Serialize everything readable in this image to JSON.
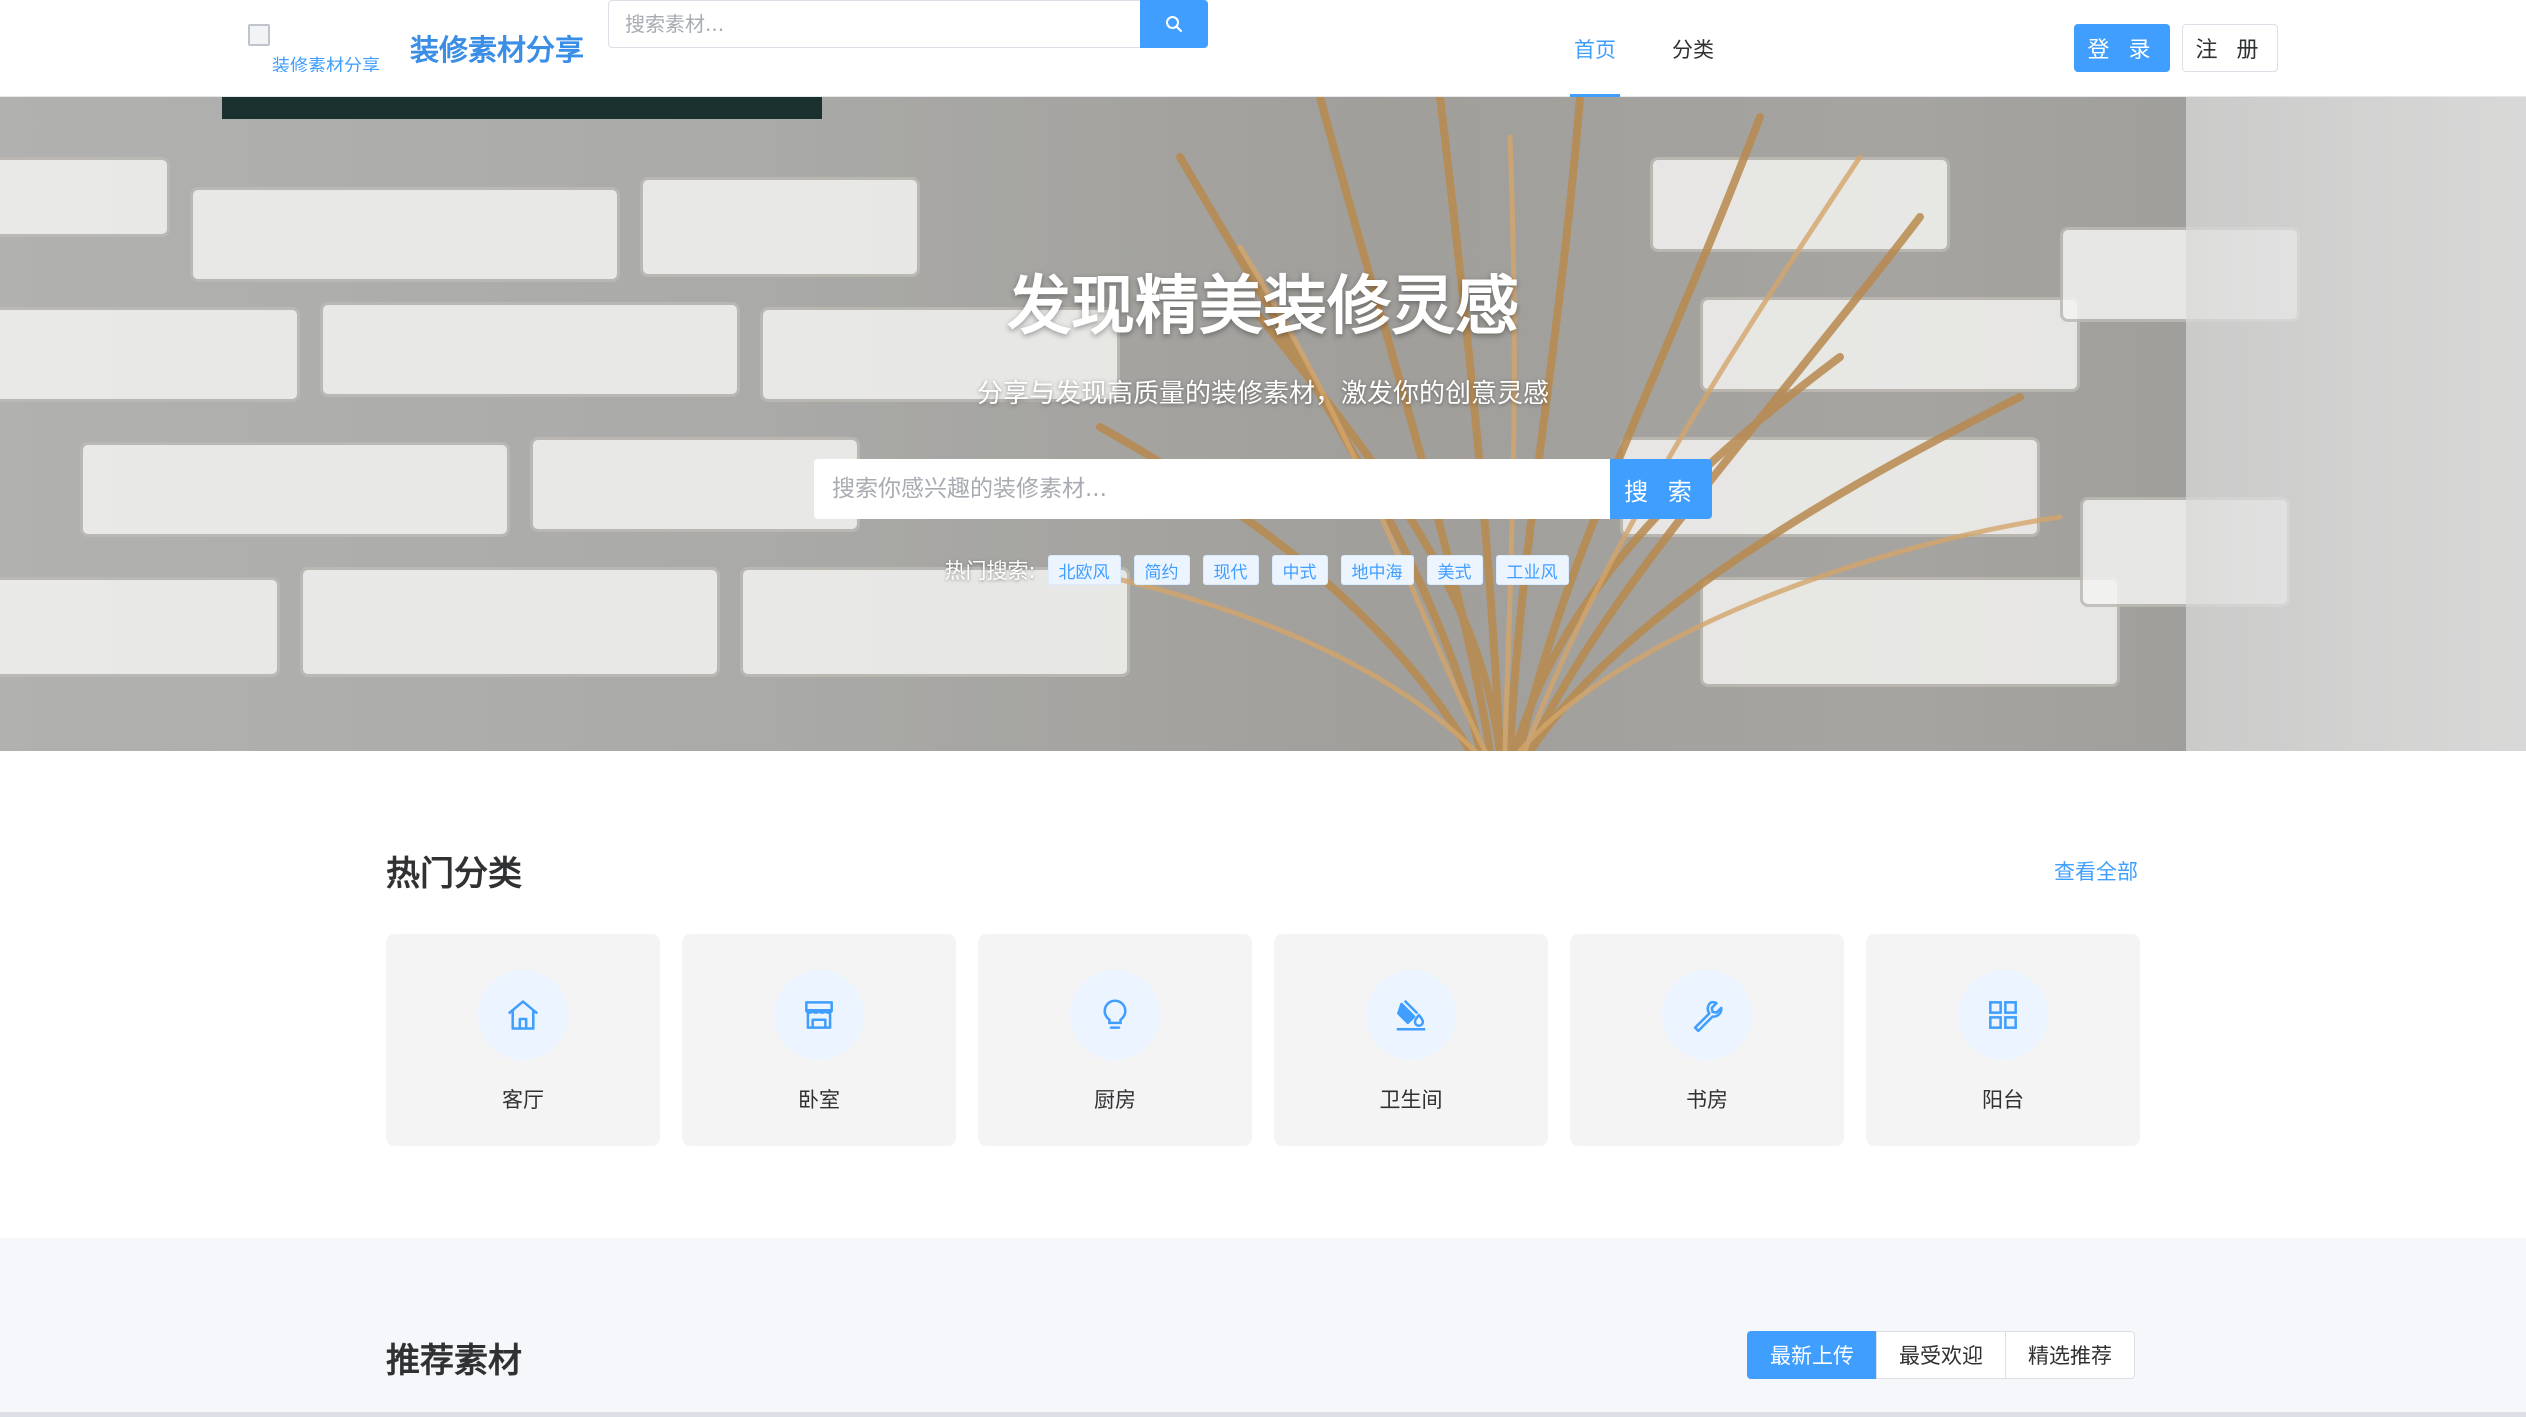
{
  "brand": {
    "logo_alt": "装修素材分享",
    "title": "装修素材分享"
  },
  "top_search": {
    "placeholder": "搜索素材..."
  },
  "nav": {
    "items": [
      "首页",
      "分类"
    ]
  },
  "auth": {
    "login": "登 录",
    "register": "注 册"
  },
  "hero": {
    "title": "发现精美装修灵感",
    "subtitle": "分享与发现高质量的装修素材，激发你的创意灵感",
    "search_placeholder": "搜索你感兴趣的装修素材...",
    "search_button": "搜 索",
    "hot_label": "热门搜索:",
    "hot_tags": [
      "北欧风",
      "简约",
      "现代",
      "中式",
      "地中海",
      "美式",
      "工业风"
    ]
  },
  "categories": {
    "title": "热门分类",
    "view_all": "查看全部",
    "items": [
      {
        "label": "客厅",
        "icon": "house-icon"
      },
      {
        "label": "卧室",
        "icon": "shop-icon"
      },
      {
        "label": "厨房",
        "icon": "lightbulb-icon"
      },
      {
        "label": "卫生间",
        "icon": "paint-bucket-icon"
      },
      {
        "label": "书房",
        "icon": "wrench-icon"
      },
      {
        "label": "阳台",
        "icon": "grid-icon"
      }
    ]
  },
  "recommended": {
    "title": "推荐素材",
    "tabs": [
      "最新上传",
      "最受欢迎",
      "精选推荐"
    ],
    "active_tab": "最新上传"
  },
  "colors": {
    "primary": "#409eff",
    "brand_title": "#3a8ee6"
  }
}
